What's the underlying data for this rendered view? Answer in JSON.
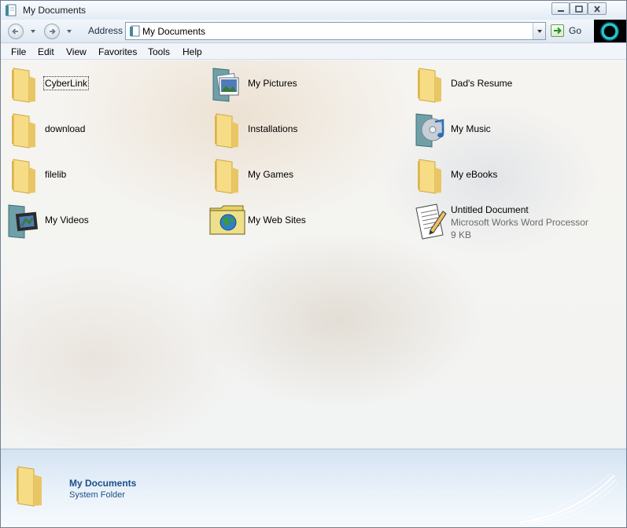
{
  "window": {
    "title": "My Documents",
    "controls": [
      "minimize",
      "maximize",
      "close"
    ]
  },
  "navigation": {
    "address_label": "Address",
    "address_value": "My Documents",
    "go_label": "Go"
  },
  "menu": {
    "items": [
      "File",
      "Edit",
      "View",
      "Favorites",
      "Tools",
      "Help"
    ]
  },
  "content": {
    "items": [
      {
        "label": "CyberLink",
        "icon": "folder-icon",
        "selected": true
      },
      {
        "label": "My Pictures",
        "icon": "pictures-folder-icon"
      },
      {
        "label": "Dad's Resume",
        "icon": "folder-icon"
      },
      {
        "label": "download",
        "icon": "folder-icon"
      },
      {
        "label": "Installations",
        "icon": "folder-icon"
      },
      {
        "label": "My Music",
        "icon": "music-folder-icon"
      },
      {
        "label": "filelib",
        "icon": "folder-icon"
      },
      {
        "label": "My Games",
        "icon": "folder-icon"
      },
      {
        "label": "My eBooks",
        "icon": "folder-icon"
      },
      {
        "label": "My Videos",
        "icon": "videos-folder-icon"
      },
      {
        "label": "My Web Sites",
        "icon": "web-sites-folder-icon"
      },
      {
        "label": "Untitled Document",
        "icon": "document-icon",
        "type": "Microsoft Works Word Processor",
        "size": "9 KB"
      }
    ]
  },
  "details": {
    "name": "My Documents",
    "type": "System Folder"
  },
  "colors": {
    "folder": "#f2d57a",
    "details_text": "#1b4f8a",
    "accent_ring": "#27c4cf"
  }
}
